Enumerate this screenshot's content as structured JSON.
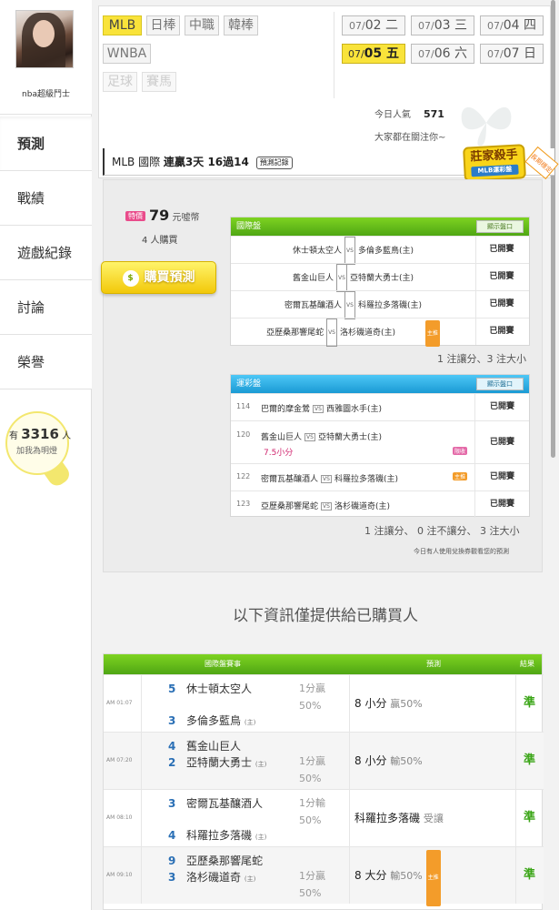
{
  "user": {
    "name": "nba超級鬥士"
  },
  "nav": [
    {
      "label": "預測"
    },
    {
      "label": "戰績"
    },
    {
      "label": "遊戲紀錄"
    },
    {
      "label": "討論"
    },
    {
      "label": "榮譽"
    }
  ],
  "fans": {
    "prefix": "有",
    "count": "3316",
    "suffix": "人",
    "caption": "加我為明燈"
  },
  "leagues": [
    {
      "label": "MLB"
    },
    {
      "label": "日棒"
    },
    {
      "label": "中職"
    },
    {
      "label": "韓棒"
    },
    {
      "label": "WNBA"
    },
    {
      "label": "足球"
    },
    {
      "label": "賽馬"
    }
  ],
  "dates": [
    {
      "md": "07/",
      "d": "02 二"
    },
    {
      "md": "07/",
      "d": "03 三"
    },
    {
      "md": "07/",
      "d": "04 四"
    },
    {
      "md": "07/",
      "d": "05 五"
    },
    {
      "md": "07/",
      "d": "06 六"
    },
    {
      "md": "07/",
      "d": "07 日"
    }
  ],
  "popularity": {
    "label": "今日人氣",
    "value": "571",
    "watching": "大家都在關注你~"
  },
  "banner": {
    "league": "MLB 國際",
    "streak": "連贏3天 16過14",
    "record_btn": "預測記錄"
  },
  "badge": {
    "title": "莊家殺手",
    "sub": "MLB運彩盤",
    "side": "長期穩定"
  },
  "price": {
    "tag": "特價",
    "amount": "79",
    "unit": "元噓幣",
    "buyers": "4 人購買"
  },
  "buy_label": "購買預測",
  "intl": {
    "title": "國際盤",
    "show": "顯示盤口",
    "rows": [
      {
        "away": "休士頓太空人",
        "vs": "VS",
        "home": "多倫多藍鳥(主)",
        "status": "已開賽",
        "flag": ""
      },
      {
        "away": "舊金山巨人",
        "vs": "VS",
        "home": "亞特蘭大勇士(主)",
        "status": "已開賽",
        "flag": ""
      },
      {
        "away": "密爾瓦基釀酒人",
        "vs": "VS",
        "home": "科羅拉多落磯(主)",
        "status": "已開賽",
        "flag": ""
      },
      {
        "away": "亞歷桑那響尾蛇",
        "vs": "VS",
        "home": "洛杉磯道奇(主)",
        "status": "已開賽",
        "flag": "主推"
      }
    ],
    "summary": "1 注讓分、3 注大小"
  },
  "lottery": {
    "title": "運彩盤",
    "show": "顯示盤口",
    "rows": [
      {
        "no": "114",
        "away": "巴爾的摩金鶯",
        "vs": "VS",
        "home": "西雅圖水手(主)",
        "extra": "",
        "status": "已開賽",
        "flag": ""
      },
      {
        "no": "120",
        "away": "舊金山巨人",
        "vs": "VS",
        "home": "亞特蘭大勇士(主)",
        "extra": "7.5小分",
        "status": "已開賽",
        "flag": "限收"
      },
      {
        "no": "122",
        "away": "密爾瓦基釀酒人",
        "vs": "VS",
        "home": "科羅拉多落磯(主)",
        "extra": "",
        "status": "已開賽",
        "flag": "主推"
      },
      {
        "no": "123",
        "away": "亞歷桑那響尾蛇",
        "vs": "VS",
        "home": "洛杉磯道奇(主)",
        "extra": "",
        "status": "已開賽",
        "flag": ""
      }
    ],
    "summary": "1 注讓分、 0 注不讓分、 3 注大小",
    "note": "今日有人使用兌換券觀看您的預測"
  },
  "notice": "以下資訊僅提供給已購買人",
  "results": {
    "headers": {
      "match": "國際盤賽事",
      "predict": "預測",
      "result": "結果"
    },
    "rows": [
      {
        "time": "AM 01:07",
        "n1": "5",
        "t1": "休士頓太空人",
        "n2": "3",
        "t2": "多倫多藍鳥",
        "home": "(主)",
        "l1": "1分贏",
        "l2": "50%",
        "pred": "8 小分",
        "pred_sub": "贏50%",
        "flag": "",
        "res": "準"
      },
      {
        "time": "AM 07:20",
        "n1": "4",
        "t1": "舊金山巨人",
        "n2": "2",
        "t2": "亞特蘭大勇士",
        "home": "(主)",
        "l1": "1分贏",
        "l2": "50%",
        "pred": "8 小分",
        "pred_sub": "輸50%",
        "flag": "",
        "res": "準"
      },
      {
        "time": "AM 08:10",
        "n1": "3",
        "t1": "密爾瓦基釀酒人",
        "n2": "4",
        "t2": "科羅拉多落磯",
        "home": "(主)",
        "l1": "1分輸",
        "l2": "50%",
        "pred": "科羅拉多落磯",
        "pred_sub": "受讓",
        "flag": "",
        "res": "準"
      },
      {
        "time": "AM 09:10",
        "n1": "9",
        "t1": "亞歷桑那響尾蛇",
        "n2": "3",
        "t2": "洛杉磯道奇",
        "home": "(主)",
        "l1": "1分贏",
        "l2": "50%",
        "pred": "8 大分",
        "pred_sub": "輸50%",
        "flag": "主推",
        "res": "準"
      }
    ]
  },
  "colors": {
    "accent_yellow": "#f9e33a",
    "green": "#4fa614",
    "blue": "#1a9ad4",
    "win": "#3aa516"
  }
}
